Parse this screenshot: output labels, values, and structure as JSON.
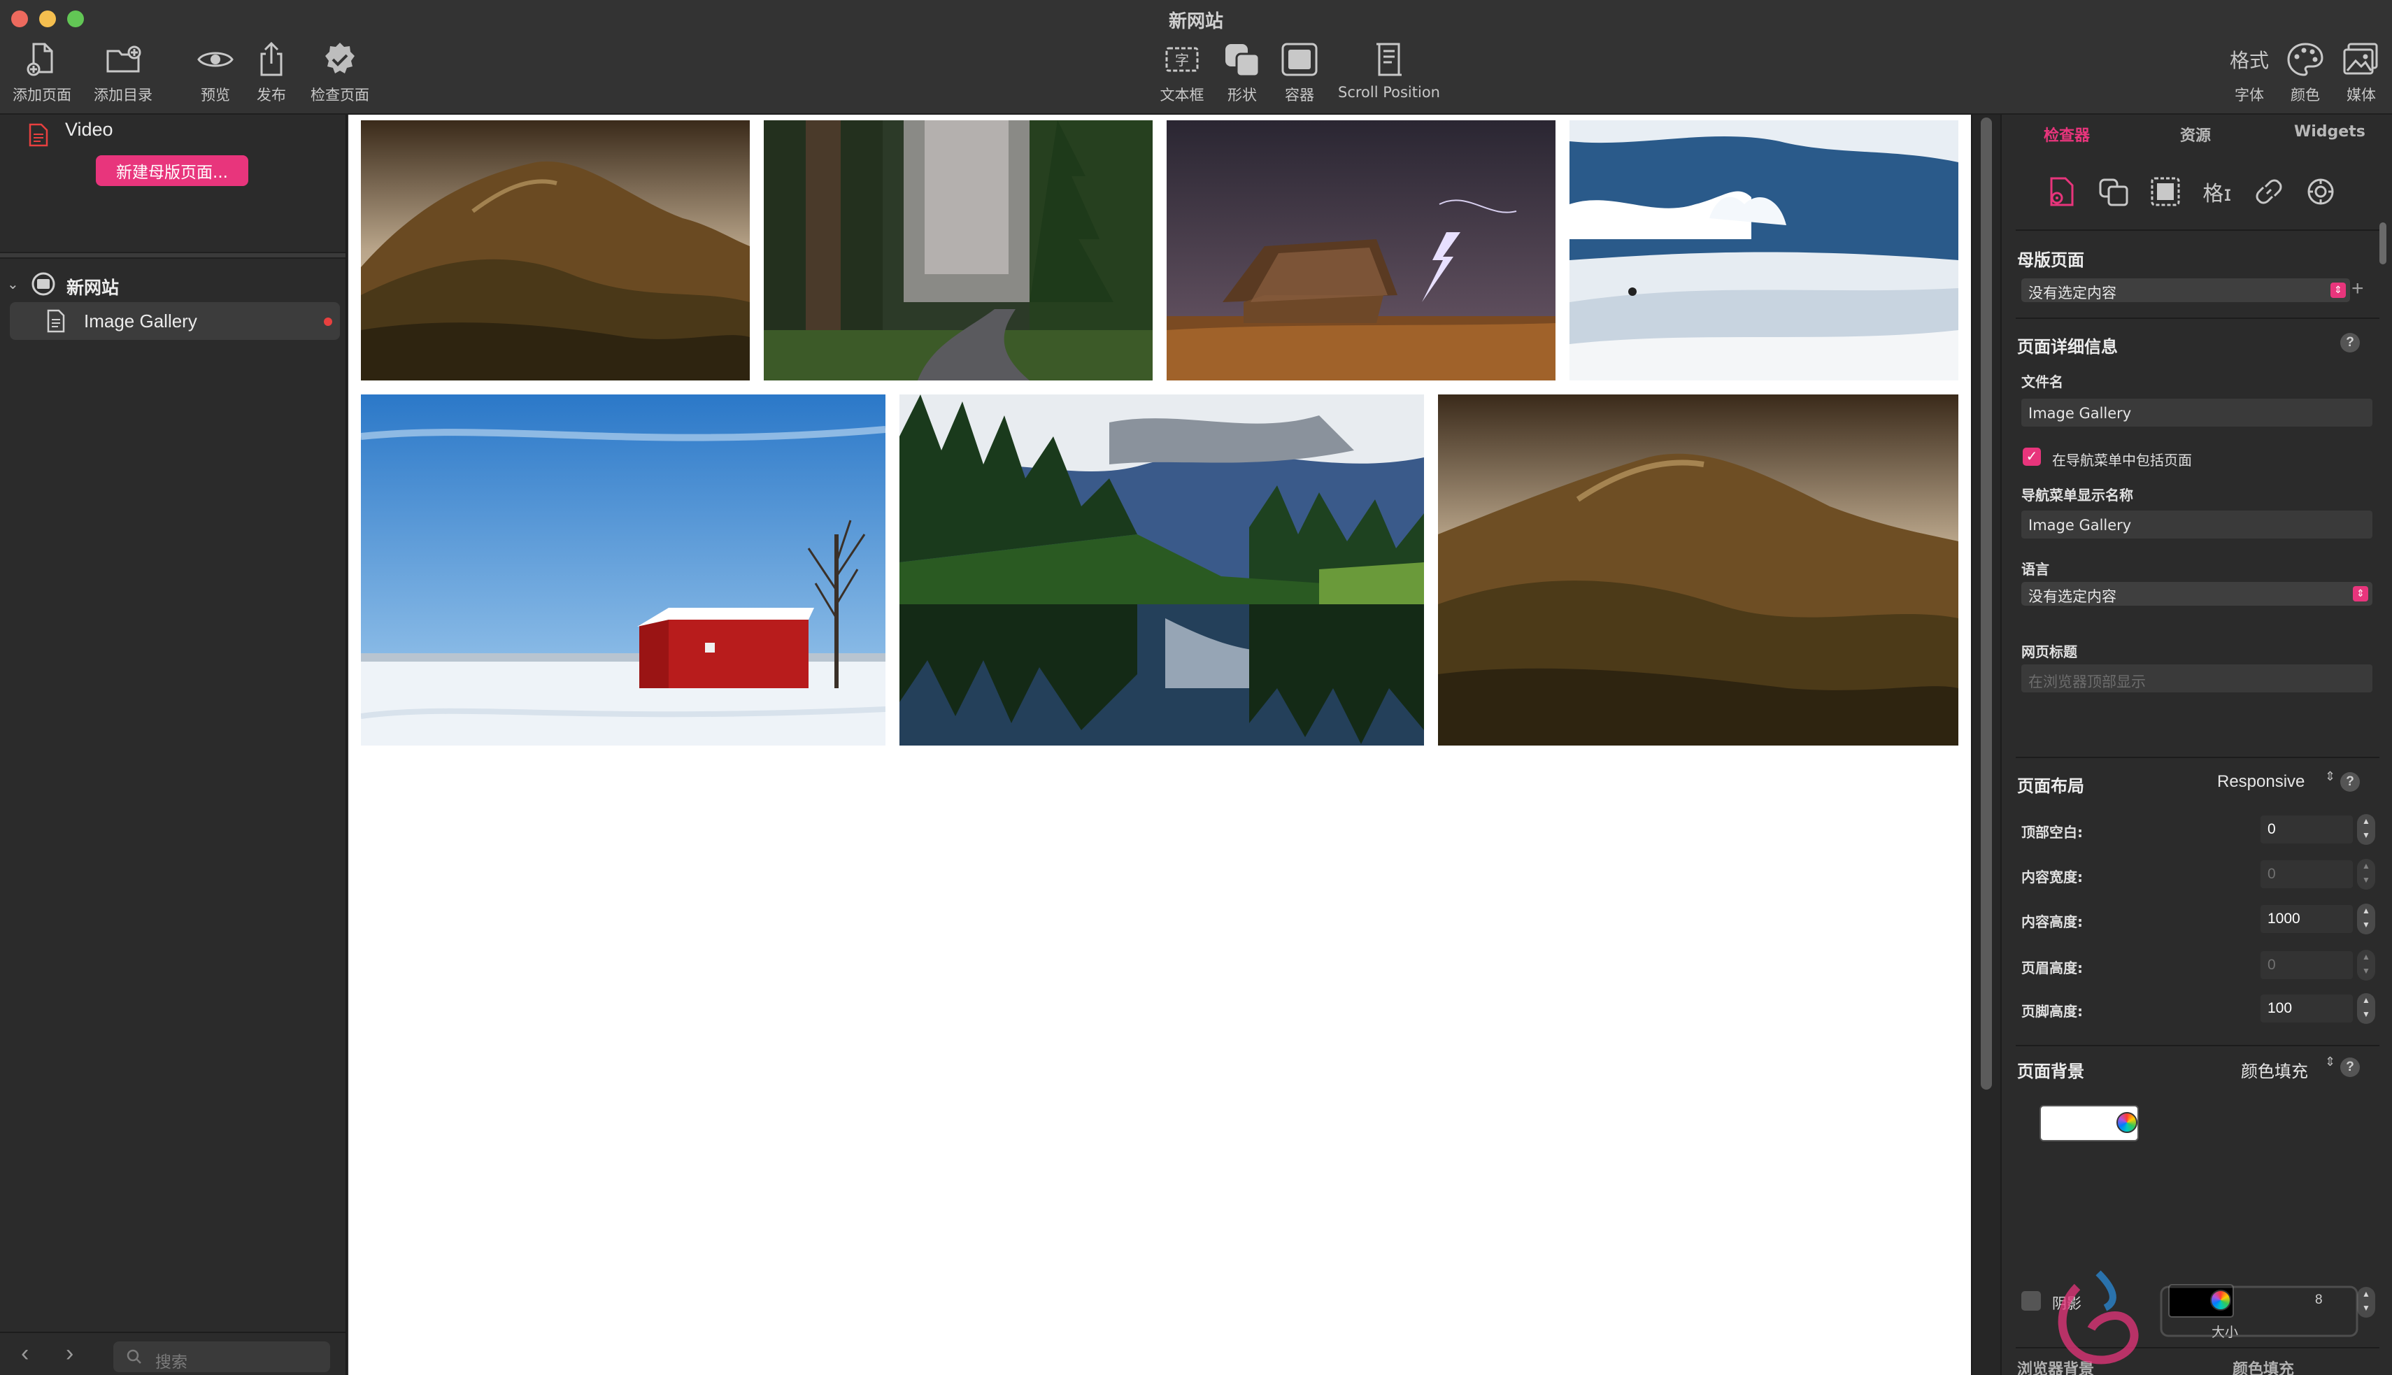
{
  "window": {
    "title": "新网站"
  },
  "toolbar": {
    "left": [
      {
        "label": "添加页面",
        "icon": "add-page-icon"
      },
      {
        "label": "添加目录",
        "icon": "add-folder-icon"
      },
      {
        "label": "预览",
        "icon": "eye-icon"
      },
      {
        "label": "发布",
        "icon": "share-icon"
      },
      {
        "label": "检查页面",
        "icon": "verified-badge-icon"
      }
    ],
    "center": [
      {
        "label": "文本框",
        "icon": "text-box-icon"
      },
      {
        "label": "形状",
        "icon": "shapes-icon"
      },
      {
        "label": "容器",
        "icon": "container-icon"
      },
      {
        "label": "Scroll Position",
        "icon": "scroll-position-icon"
      }
    ],
    "right": [
      {
        "label": "字体",
        "icon": "format-glyph",
        "glyph": "格式"
      },
      {
        "label": "颜色",
        "icon": "palette-icon"
      },
      {
        "label": "媒体",
        "icon": "media-icon"
      }
    ]
  },
  "sidebar": {
    "template_item": "Video",
    "new_master_button": "新建母版页面...",
    "site_name": "新网站",
    "page_name": "Image Gallery",
    "search_placeholder": "搜索"
  },
  "canvas": {
    "images": [
      {
        "name": "rolling-hills-photo",
        "subject": "hills"
      },
      {
        "name": "forest-road-photo",
        "subject": "forest road"
      },
      {
        "name": "lightning-barn-photo",
        "subject": "lightning barn"
      },
      {
        "name": "snow-clouds-photo",
        "subject": "snow clouds"
      },
      {
        "name": "red-barn-snow-photo",
        "subject": "red barn"
      },
      {
        "name": "forest-lake-photo",
        "subject": "forest lake"
      },
      {
        "name": "rolling-hills-wide-photo",
        "subject": "hills"
      }
    ]
  },
  "inspector": {
    "tabs": [
      "检查器",
      "资源",
      "Widgets"
    ],
    "active_tab": "检查器",
    "master_page": {
      "title": "母版页面",
      "value": "没有选定内容"
    },
    "page_details": {
      "title": "页面详细信息",
      "filename_label": "文件名",
      "filename": "Image Gallery",
      "include_in_nav_label": "在导航菜单中包括页面",
      "include_in_nav": true,
      "nav_name_label": "导航菜单显示名称",
      "nav_name": "Image Gallery",
      "language_label": "语言",
      "language": "没有选定内容",
      "page_title_label": "网页标题",
      "page_title_placeholder": "在浏览器顶部显示"
    },
    "layout": {
      "title": "页面布局",
      "mode": "Responsive",
      "rows": [
        {
          "label": "顶部空白:",
          "value": "0",
          "enabled": true
        },
        {
          "label": "内容宽度:",
          "value": "0",
          "enabled": false
        },
        {
          "label": "内容高度:",
          "value": "1000",
          "enabled": true
        },
        {
          "label": "页眉高度:",
          "value": "0",
          "enabled": false
        },
        {
          "label": "页脚高度:",
          "value": "100",
          "enabled": true
        }
      ]
    },
    "background": {
      "title": "页面背景",
      "fill_mode": "颜色填充",
      "color": "#ffffff"
    },
    "shadow": {
      "label": "阴影",
      "size_label": "大小",
      "value": "8",
      "color": "#000000"
    },
    "bottom_section": {
      "title": "浏览器背景",
      "fill_mode": "颜色填充"
    }
  },
  "colors": {
    "accent": "#e8357c",
    "panel": "#2b2b2b",
    "toolbar": "#333333"
  }
}
